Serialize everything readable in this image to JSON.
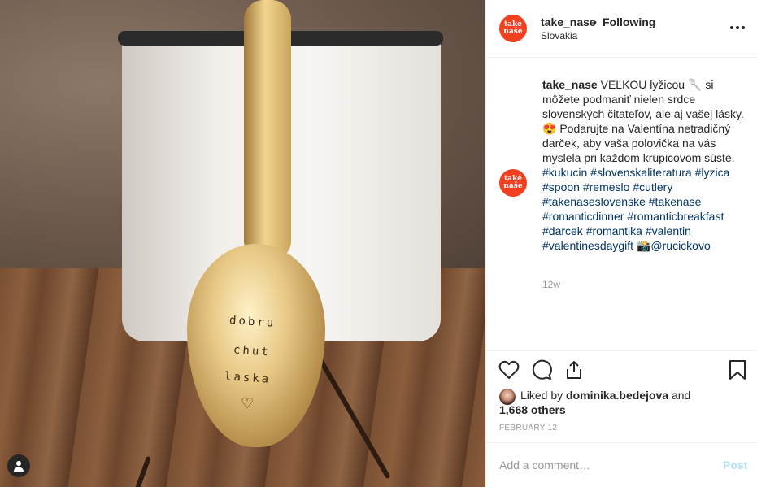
{
  "post": {
    "username": "take_nase",
    "separator": "•",
    "follow_status": "Following",
    "location": "Slovakia",
    "avatar_text_top": "také",
    "avatar_text_bottom": "naše",
    "avatar_color": "#f0401f",
    "photo_engraving": [
      "dobru",
      "chut",
      "laska"
    ]
  },
  "caption": {
    "username": "take_nase",
    "text_1": "VEĽKOU lyžicou",
    "emoji_spoon": "🥄",
    "text_2": "si môžete podmaniť nielen srdce slovenských čitateľov, ale aj vašej lásky.",
    "emoji_hearts": "😍",
    "text_3": "Podarujte na Valentína netradičný darček, aby vaša polovička na vás myslela pri každom krupicovom súste.",
    "hashtags": [
      "#kukucin",
      "#slovenskaliteratura",
      "#lyzica",
      "#spoon",
      "#remeslo",
      "#cutlery",
      "#takenaseslovenske",
      "#takenase",
      "#romanticdinner",
      "#romanticbreakfast",
      "#darcek",
      "#romantika",
      "#valentin",
      "#valentinesdaygift"
    ],
    "emoji_camera": "📸",
    "mention": "@rucickovo",
    "time_ago": "12w"
  },
  "likes": {
    "liked_by_prefix": "Liked by",
    "liked_by_user": "dominika.bedejova",
    "and": "and",
    "others": "1,668 others"
  },
  "date": "FEBRUARY 12",
  "comment": {
    "placeholder": "Add a comment…",
    "post_label": "Post"
  },
  "icons": {
    "like": "heart-outline-icon",
    "comment": "speech-bubble-icon",
    "share": "share-icon",
    "save": "bookmark-icon",
    "more": "more-options-icon",
    "user_tag": "user-tag-icon"
  },
  "colors": {
    "link": "#003569",
    "muted": "#999999",
    "post_disabled": "#b2dffc"
  }
}
